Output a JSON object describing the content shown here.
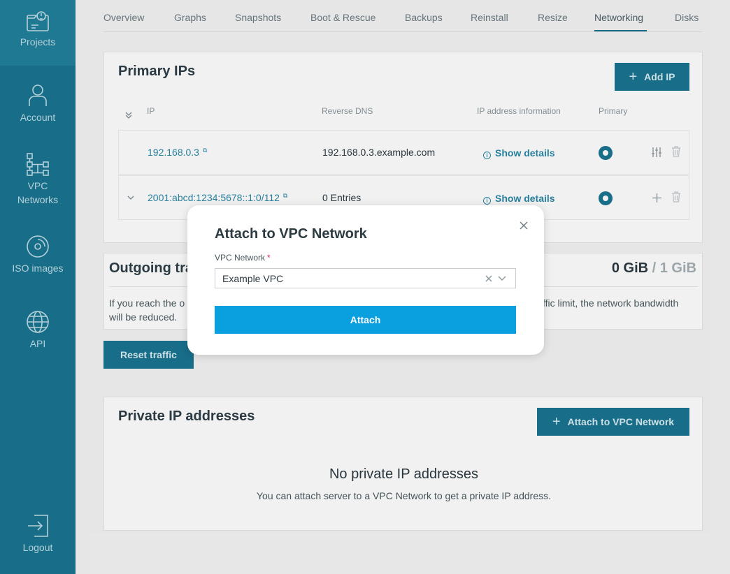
{
  "sidebar": {
    "items": [
      {
        "label": "Projects",
        "icon": "projects-icon"
      },
      {
        "label": "Account",
        "icon": "account-icon"
      },
      {
        "label_line1": "VPC",
        "label_line2": "Networks",
        "icon": "vpc-networks-icon"
      },
      {
        "label": "ISO images",
        "icon": "iso-images-icon"
      },
      {
        "label": "API",
        "icon": "api-icon"
      },
      {
        "label": "Logout",
        "icon": "logout-icon"
      }
    ]
  },
  "tabs": [
    "Overview",
    "Graphs",
    "Snapshots",
    "Boot & Rescue",
    "Backups",
    "Reinstall",
    "Resize",
    "Networking",
    "Disks"
  ],
  "primary_ips": {
    "title": "Primary IPs",
    "add_button": "Add IP",
    "columns": [
      "IP",
      "Reverse DNS",
      "IP address information",
      "Primary"
    ],
    "rows": [
      {
        "ip": "192.168.0.3",
        "reverse_dns": "192.168.0.3.example.com",
        "info": "Show details"
      },
      {
        "ip": "2001:abcd:1234:5678::1:0/112",
        "reverse_dns": "0 Entries",
        "info": "Show details"
      }
    ]
  },
  "traffic": {
    "title": "Outgoing tra",
    "used": "0 GiB",
    "limit": "/ 1 GiB",
    "info_left_line1": "If you reach the o",
    "info_left_line2": "will be reduced.",
    "info_right": "ffic limit, the network bandwidth",
    "reset_button": "Reset traffic"
  },
  "private_ips": {
    "title": "Private IP addresses",
    "attach_button": "Attach to VPC Network",
    "empty_title": "No private IP addresses",
    "empty_text": "You can attach server to a VPC Network to get a private IP address."
  },
  "modal": {
    "title": "Attach to VPC Network",
    "field_label": "VPC Network",
    "required_mark": "*",
    "selected_value": "Example VPC",
    "submit": "Attach"
  },
  "colors": {
    "sidebar": "#1a7490",
    "primary_button": "#1a7490",
    "attach_button": "#0aa0e0",
    "link": "#2a88a8"
  }
}
